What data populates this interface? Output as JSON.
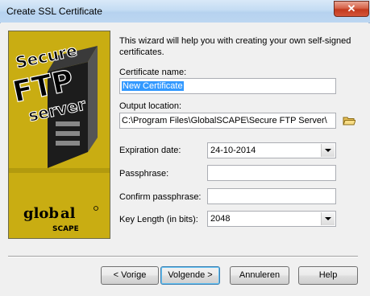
{
  "window": {
    "title": "Create SSL Certificate",
    "close_glyph": "✕"
  },
  "side_image": {
    "logo_lines": [
      "Secure",
      "FTP",
      "server"
    ],
    "brand": [
      "glob",
      "al",
      "SCAPE"
    ]
  },
  "intro_text": "This wizard will help you with creating your own self-signed certificates.",
  "fields": {
    "cert_name_label": "Certificate name:",
    "cert_name_value": "New Certificate",
    "output_label": "Output location:",
    "output_value": "C:\\Program Files\\GlobalSCAPE\\Secure FTP Server\\",
    "expiration_label": "Expiration date:",
    "expiration_value": "24-10-2014",
    "passphrase_label": "Passphrase:",
    "passphrase_value": "",
    "confirm_label": "Confirm passphrase:",
    "confirm_value": "",
    "key_length_label": "Key Length (in bits):",
    "key_length_value": "2048"
  },
  "buttons": {
    "back": "< Vorige",
    "next": "Volgende >",
    "cancel": "Annuleren",
    "help": "Help"
  },
  "icons": [
    "folder-icon",
    "chevron-down-icon",
    "close-icon"
  ],
  "colors": {
    "side_panel": "#c5aa10",
    "selection": "#3399ff",
    "titlebar": "#c4dcf3"
  }
}
